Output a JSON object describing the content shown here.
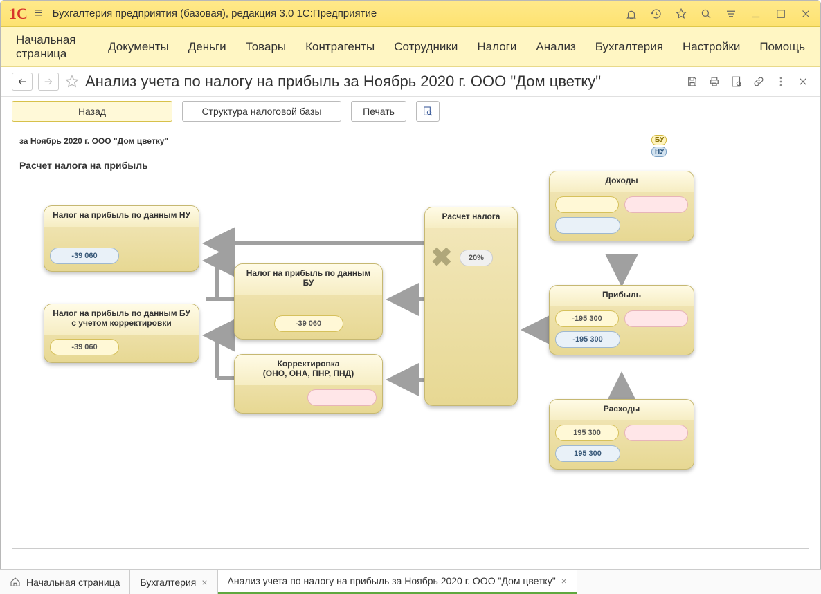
{
  "titlebar": {
    "app_title": "Бухгалтерия предприятия (базовая), редакция 3.0 1С:Предприятие"
  },
  "mainmenu": {
    "items": [
      "Начальная страница",
      "Документы",
      "Деньги",
      "Товары",
      "Контрагенты",
      "Сотрудники",
      "Налоги",
      "Анализ",
      "Бухгалтерия",
      "Настройки",
      "Помощь"
    ]
  },
  "report": {
    "title": "Анализ учета по налогу на прибыль за Ноябрь 2020 г. ООО \"Дом цветку\"",
    "back_label": "Назад",
    "structure_label": "Структура налоговой базы",
    "print_label": "Печать"
  },
  "canvas": {
    "period_line": "за Ноябрь 2020 г. ООО \"Дом цветку\"",
    "section_title": "Расчет налога на прибыль",
    "legend_bu": "БУ",
    "legend_nu": "НУ"
  },
  "blocks": {
    "tax_nu": {
      "title": "Налог на прибыль по данным НУ",
      "value": "-39 060"
    },
    "tax_bu_corr": {
      "title": "Налог на прибыль по данным БУ с учетом корректировки",
      "value": "-39 060"
    },
    "tax_bu": {
      "title": "Налог на прибыль по данным БУ",
      "value": "-39 060"
    },
    "correction": {
      "title": "Корректировка\n(ОНО, ОНА, ПНР, ПНД)"
    },
    "calc": {
      "title": "Расчет налога",
      "rate": "20%"
    },
    "income": {
      "title": "Доходы"
    },
    "profit": {
      "title": "Прибыль",
      "yellow": "-195 300",
      "blue": "-195 300"
    },
    "expense": {
      "title": "Расходы",
      "yellow": "195 300",
      "blue": "195 300"
    }
  },
  "tabs": {
    "home": "Начальная страница",
    "accounting": "Бухгалтерия",
    "report": "Анализ учета по налогу на прибыль за Ноябрь 2020 г. ООО \"Дом цветку\""
  }
}
